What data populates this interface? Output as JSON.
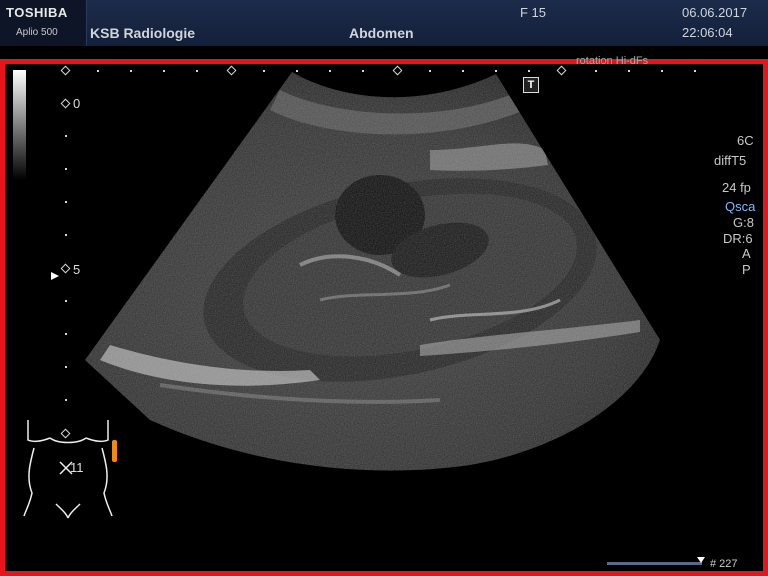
{
  "header": {
    "brand": "TOSHIBA",
    "model": "Aplio 500",
    "institution": "KSB Radiologie",
    "exam": "Abdomen",
    "frequency": "F  15",
    "date": "06.06.2017",
    "time": "22:06:04"
  },
  "image": {
    "depth_labels": [
      "0",
      "5"
    ],
    "transducer_marker": "T",
    "parameters": [
      "6C",
      "diffT5",
      "24 fp",
      "Qsca",
      "G:8",
      "DR:6",
      "A",
      "P"
    ],
    "bodymark_label": "11",
    "partial_top_text": "rotation  Hi-dFs",
    "frame_counter": "# 227"
  },
  "colors": {
    "frame_border": "#e8141c",
    "header_bg": "#1c2b4a",
    "bodymark_probe": "#f08a10"
  },
  "icons": [
    "transducer-orientation-icon",
    "focus-arrow-icon",
    "body-mark-icon",
    "probe-position-icon"
  ]
}
